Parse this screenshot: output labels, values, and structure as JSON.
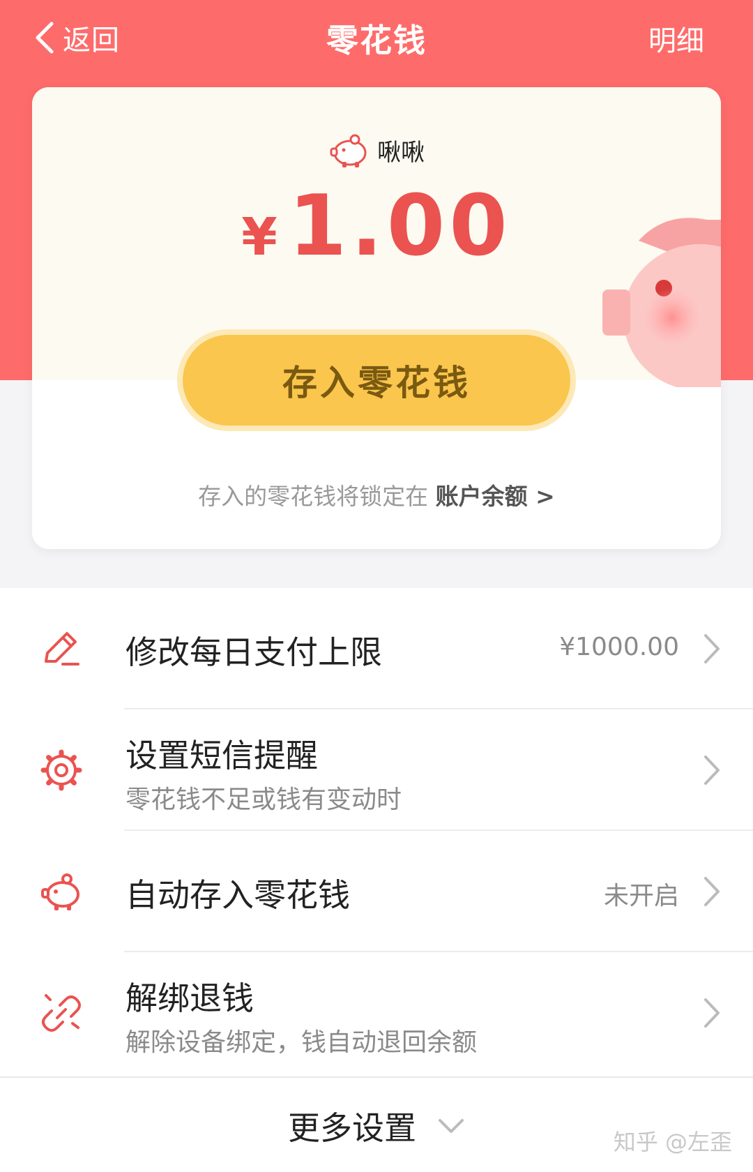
{
  "nav": {
    "back_label": "返回",
    "title": "零花钱",
    "detail_label": "明细"
  },
  "card": {
    "owner_name": "啾啾",
    "currency": "¥",
    "amount": "1.00",
    "deposit_label": "存入零花钱",
    "lock_note": "存入的零花钱将锁定在",
    "lock_link": "账户余额 >"
  },
  "settings": [
    {
      "icon": "pencil-icon",
      "title": "修改每日支付上限",
      "value": "¥1000.00"
    },
    {
      "icon": "gear-icon",
      "title": "设置短信提醒",
      "subtitle": "零花钱不足或钱有变动时"
    },
    {
      "icon": "piggy-bank-icon",
      "title": "自动存入零花钱",
      "value": "未开启"
    },
    {
      "icon": "unlink-icon",
      "title": "解绑退钱",
      "subtitle": "解除设备绑定，钱自动退回余额"
    }
  ],
  "more": {
    "label": "更多设置"
  },
  "watermark": "知乎 @左歪",
  "colors": {
    "header": "#fd6c6b",
    "accent": "#ea5350",
    "button": "#fbc64e",
    "card_top": "#fdfaf1"
  }
}
